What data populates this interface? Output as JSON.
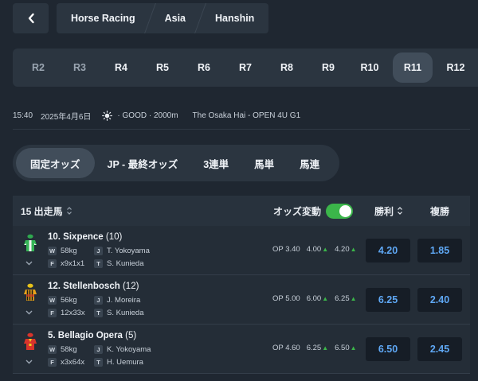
{
  "breadcrumbs": [
    "Horse Racing",
    "Asia",
    "Hanshin"
  ],
  "race_tabs": [
    "R2",
    "R3",
    "R4",
    "R5",
    "R6",
    "R7",
    "R8",
    "R9",
    "R10",
    "R11",
    "R12"
  ],
  "active_race": "R11",
  "info": {
    "time": "15:40",
    "date": "2025年4月6日",
    "conditions": "· GOOD · 2000m",
    "race_name": "The Osaka Hai - OPEN 4U G1"
  },
  "odds_tabs": [
    "固定オッズ",
    "JP - 最終オッズ",
    "3連単",
    "馬単",
    "馬連"
  ],
  "table": {
    "runners_label": "15 出走馬",
    "odds_change_label": "オッズ変動",
    "win_label": "勝利",
    "place_label": "複勝"
  },
  "runners": [
    {
      "name": "10. Sixpence",
      "barrier": "(10)",
      "weight": "58kg",
      "jockey": "T. Yokoyama",
      "form": "x9x1x1",
      "trainer": "S. Kunieda",
      "op": "OP 3.40",
      "flucs": [
        "4.00",
        "4.20"
      ],
      "win": "4.20",
      "place": "1.85"
    },
    {
      "name": "12. Stellenbosch",
      "barrier": "(12)",
      "weight": "56kg",
      "jockey": "J. Moreira",
      "form": "12x33x",
      "trainer": "S. Kunieda",
      "op": "OP 5.00",
      "flucs": [
        "6.00",
        "6.25"
      ],
      "win": "6.25",
      "place": "2.40"
    },
    {
      "name": "5. Bellagio Opera",
      "barrier": "(5)",
      "weight": "58kg",
      "jockey": "K. Yokoyama",
      "form": "x3x64x",
      "trainer": "H. Uemura",
      "op": "OP 4.60",
      "flucs": [
        "6.25",
        "6.50"
      ],
      "win": "6.50",
      "place": "2.45"
    }
  ],
  "labels": {
    "W": "W",
    "J": "J",
    "F": "F",
    "T": "T"
  },
  "colors": {
    "accent_blue": "#5fa8f5",
    "toggle_green": "#3bb54a",
    "background": "#1f2731"
  }
}
